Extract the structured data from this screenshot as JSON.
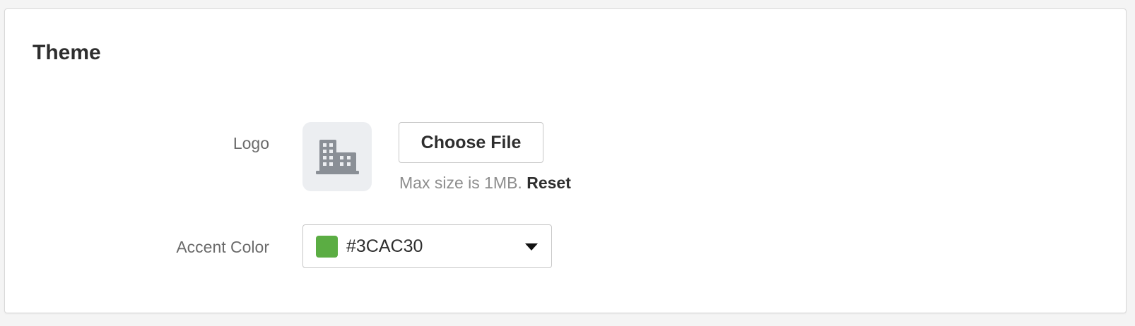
{
  "section": {
    "title": "Theme"
  },
  "logo": {
    "label": "Logo",
    "placeholder_icon": "building-icon",
    "choose_button_label": "Choose File",
    "hint_text": "Max size is 1MB.",
    "reset_label": "Reset"
  },
  "accent": {
    "label": "Accent Color",
    "value": "#3CAC30",
    "swatch_color": "#5bad43",
    "dropdown_icon": "caret-down-icon"
  },
  "colors": {
    "icon_gray": "#8a8f96",
    "preview_bg": "#eceef1"
  }
}
